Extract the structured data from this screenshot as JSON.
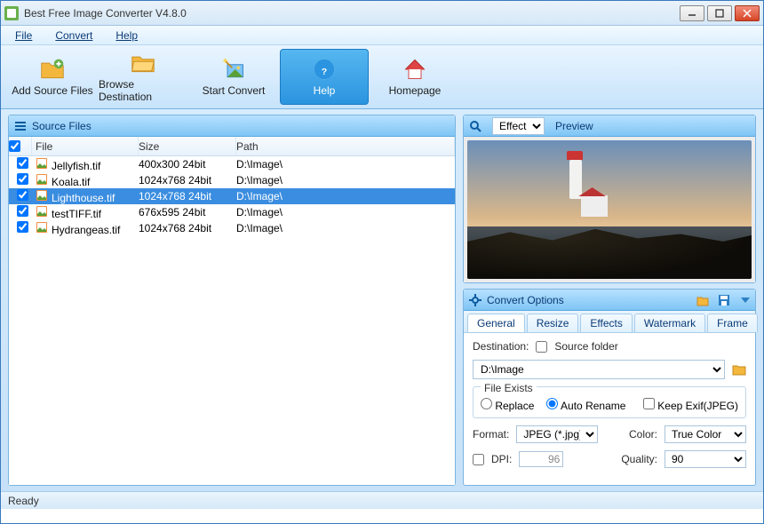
{
  "window": {
    "title": "Best Free Image Converter V4.8.0"
  },
  "menu": {
    "file": "File",
    "convert": "Convert",
    "help": "Help"
  },
  "toolbar": {
    "add": "Add Source Files",
    "browse": "Browse Destination",
    "start": "Start Convert",
    "help": "Help",
    "home": "Homepage"
  },
  "left_panel": {
    "title": "Source Files",
    "cols": {
      "file": "File",
      "size": "Size",
      "path": "Path"
    },
    "rows": [
      {
        "file": "Jellyfish.tif",
        "size": "400x300  24bit",
        "path": "D:\\Image\\",
        "checked": true,
        "selected": false
      },
      {
        "file": "Koala.tif",
        "size": "1024x768  24bit",
        "path": "D:\\Image\\",
        "checked": true,
        "selected": false
      },
      {
        "file": "Lighthouse.tif",
        "size": "1024x768  24bit",
        "path": "D:\\Image\\",
        "checked": true,
        "selected": true
      },
      {
        "file": "testTIFF.tif",
        "size": "676x595  24bit",
        "path": "D:\\Image\\",
        "checked": true,
        "selected": false
      },
      {
        "file": "Hydrangeas.tif",
        "size": "1024x768  24bit",
        "path": "D:\\Image\\",
        "checked": true,
        "selected": false
      }
    ]
  },
  "preview": {
    "effect_selected": "Effect",
    "label": "Preview"
  },
  "options": {
    "title": "Convert Options",
    "tabs": [
      "General",
      "Resize",
      "Effects",
      "Watermark",
      "Frame"
    ],
    "active_tab": 0,
    "destination_label": "Destination:",
    "source_folder_label": "Source folder",
    "source_folder_checked": false,
    "destination_value": "D:\\Image",
    "file_exists_label": "File Exists",
    "replace_label": "Replace",
    "auto_rename_label": "Auto Rename",
    "file_exists_value": "auto_rename",
    "keep_exif_label": "Keep Exif(JPEG)",
    "keep_exif_checked": false,
    "format_label": "Format:",
    "format_value": "JPEG (*.jpg)",
    "color_label": "Color:",
    "color_value": "True Color",
    "dpi_label": "DPI:",
    "dpi_checked": false,
    "dpi_value": "96",
    "quality_label": "Quality:",
    "quality_value": "90"
  },
  "status": "Ready"
}
